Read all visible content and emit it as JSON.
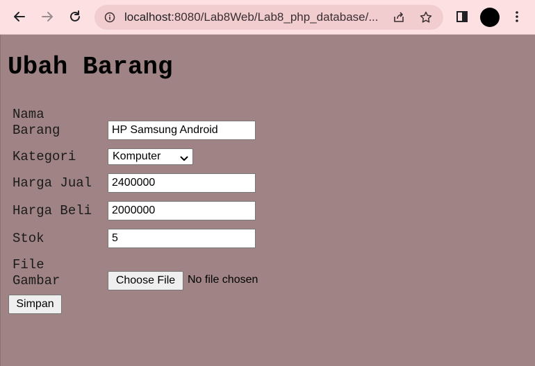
{
  "browser": {
    "url_host": "localhost",
    "url_rest": ":8080/Lab8Web/Lab8_php_database/...",
    "icons": [
      "back-arrow-icon",
      "forward-arrow-icon",
      "reload-icon",
      "info-icon",
      "share-icon",
      "star-icon",
      "side-panel-icon",
      "avatar",
      "menu-dots-icon"
    ]
  },
  "page": {
    "title": "Ubah Barang"
  },
  "form": {
    "nama_label_1": "Nama",
    "nama_label_2": "Barang",
    "nama_value": "HP Samsung Android",
    "kategori_label": "Kategori",
    "kategori_value": "Komputer",
    "harga_jual_label": "Harga Jual",
    "harga_jual_value": "2400000",
    "harga_beli_label": "Harga Beli",
    "harga_beli_value": "2000000",
    "stok_label": "Stok",
    "stok_value": "5",
    "file_label_1": "File",
    "file_label_2": "Gambar",
    "file_button_label": "Choose File",
    "file_status": "No file chosen",
    "submit_label": "Simpan"
  }
}
